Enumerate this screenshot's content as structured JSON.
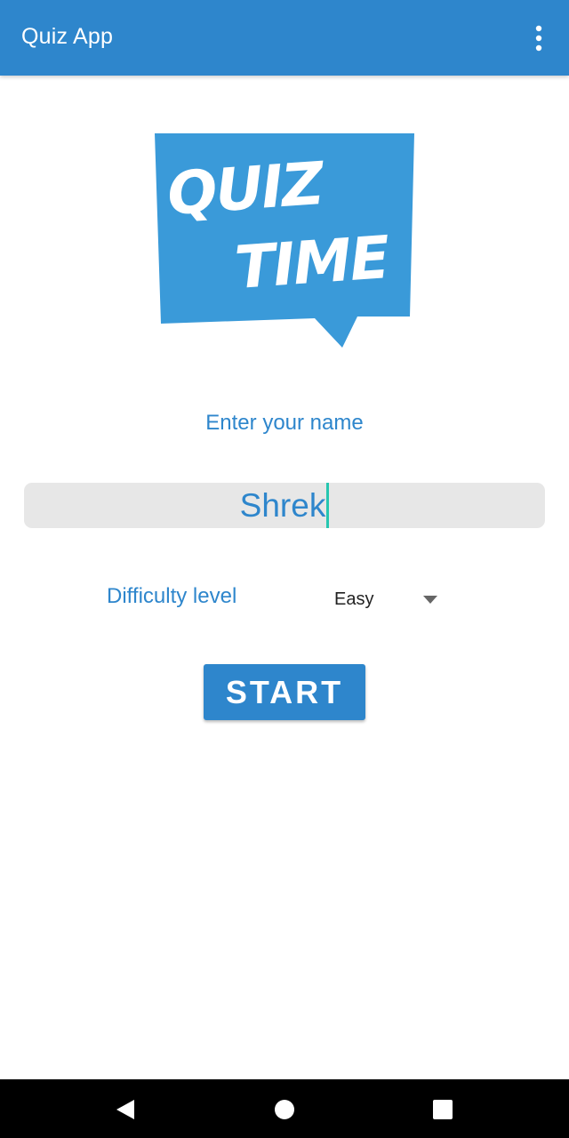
{
  "app_bar": {
    "title": "Quiz App",
    "overflow_icon": "more-vertical-icon",
    "color": "#2e86cc"
  },
  "logo": {
    "line1": "QUIZ",
    "line2": "TIME !",
    "bubble_color": "#3a9ad9"
  },
  "form": {
    "name_label": "Enter your name",
    "name_value": "Shrek",
    "difficulty_label": "Difficulty level",
    "difficulty_value": "Easy",
    "dropdown_icon": "triangle-down-icon",
    "accent_color": "#2e86cc",
    "caret_color": "#26c6b0"
  },
  "start_button": {
    "label": "START"
  },
  "nav_bar": {
    "back_icon": "back-triangle-icon",
    "home_icon": "home-circle-icon",
    "recents_icon": "recents-square-icon"
  }
}
